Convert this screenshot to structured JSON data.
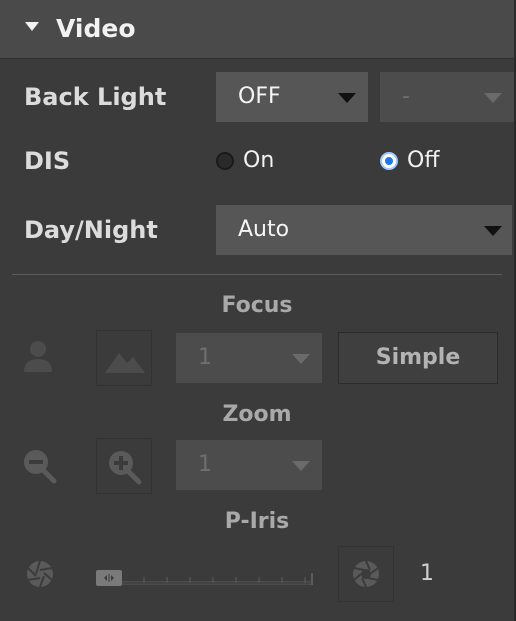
{
  "panel": {
    "title": "Video"
  },
  "back_light": {
    "label": "Back Light",
    "mode_value": "OFF",
    "level_value": "-"
  },
  "dis": {
    "label": "DIS",
    "options": [
      {
        "label": "On",
        "checked": false
      },
      {
        "label": "Off",
        "checked": true
      }
    ]
  },
  "day_night": {
    "label": "Day/Night",
    "value": "Auto"
  },
  "focus": {
    "title": "Focus",
    "near_icon": "person-icon",
    "far_icon": "mountain-icon",
    "step_value": "1",
    "simple_label": "Simple"
  },
  "zoom": {
    "title": "Zoom",
    "out_icon": "zoom-out-icon",
    "in_icon": "zoom-in-icon",
    "step_value": "1"
  },
  "p_iris": {
    "title": "P-Iris",
    "close_icon": "aperture-close-icon",
    "open_icon": "aperture-open-icon",
    "value": "1",
    "level_fraction": 0.0
  },
  "colors": {
    "panel_bg": "#3b3b3b",
    "header_bg": "#4a4a4a",
    "select_bg": "#565656",
    "radio_accent": "#1f78e8"
  }
}
